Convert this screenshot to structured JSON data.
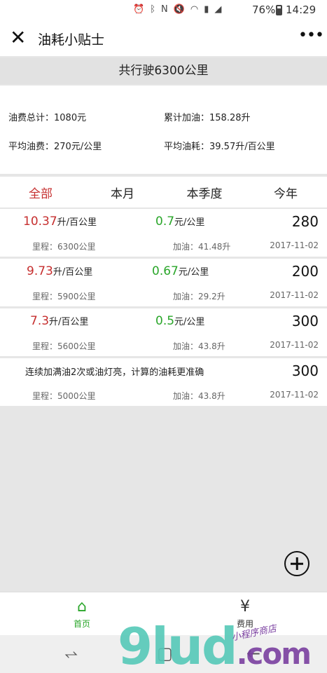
{
  "status": {
    "battery": "76%",
    "time": "14:29",
    "signal_icons": [
      "alarm-icon",
      "bluetooth-icon",
      "nfc-icon",
      "mute-icon",
      "wifi-icon",
      "sim-icon",
      "4g-icon",
      "signal-icon"
    ]
  },
  "nav": {
    "title": "油耗小贴士",
    "close_glyph": "✕",
    "more_glyph": "•••"
  },
  "summary": {
    "total_distance": "共行驶6300公里"
  },
  "stats": {
    "fuel_cost_total": "油费总计：1080元",
    "fuel_added_total": "累计加油：158.28升",
    "avg_cost": "平均油费：270元/公里",
    "avg_consumption": "平均油耗：39.57升/百公里"
  },
  "tabs": [
    {
      "label": "全部",
      "active": true
    },
    {
      "label": "本月",
      "active": false
    },
    {
      "label": "本季度",
      "active": false
    },
    {
      "label": "今年",
      "active": false
    }
  ],
  "records": [
    {
      "consumption": "10.37",
      "consumption_unit": "升/百公里",
      "cost": "0.7",
      "cost_unit": "元/公里",
      "amount": "280",
      "mileage": "里程：6300公里",
      "fuel": "加油：41.48升",
      "date": "2017-11-02",
      "note": ""
    },
    {
      "consumption": "9.73",
      "consumption_unit": "升/百公里",
      "cost": "0.67",
      "cost_unit": "元/公里",
      "amount": "200",
      "mileage": "里程：5900公里",
      "fuel": "加油：29.2升",
      "date": "2017-11-02",
      "note": ""
    },
    {
      "consumption": "7.3",
      "consumption_unit": "升/百公里",
      "cost": "0.5",
      "cost_unit": "元/公里",
      "amount": "300",
      "mileage": "里程：5600公里",
      "fuel": "加油：43.8升",
      "date": "2017-11-02",
      "note": ""
    },
    {
      "consumption": "",
      "consumption_unit": "",
      "cost": "",
      "cost_unit": "",
      "amount": "300",
      "mileage": "里程：5000公里",
      "fuel": "加油：43.8升",
      "date": "2017-11-02",
      "note": "连续加满油2次或油灯亮，计算的油耗更准确"
    }
  ],
  "bottom_nav": [
    {
      "label": "首页",
      "icon": "home-icon",
      "glyph": "⌂",
      "active": true
    },
    {
      "label": "费用",
      "icon": "yen-icon",
      "glyph": "¥",
      "active": false
    }
  ],
  "watermark": {
    "text": "9lud",
    "suffix": ".com",
    "tagline": "小程序商店"
  },
  "colors": {
    "accent_red": "#c62f2f",
    "accent_green": "#2aa62a"
  }
}
